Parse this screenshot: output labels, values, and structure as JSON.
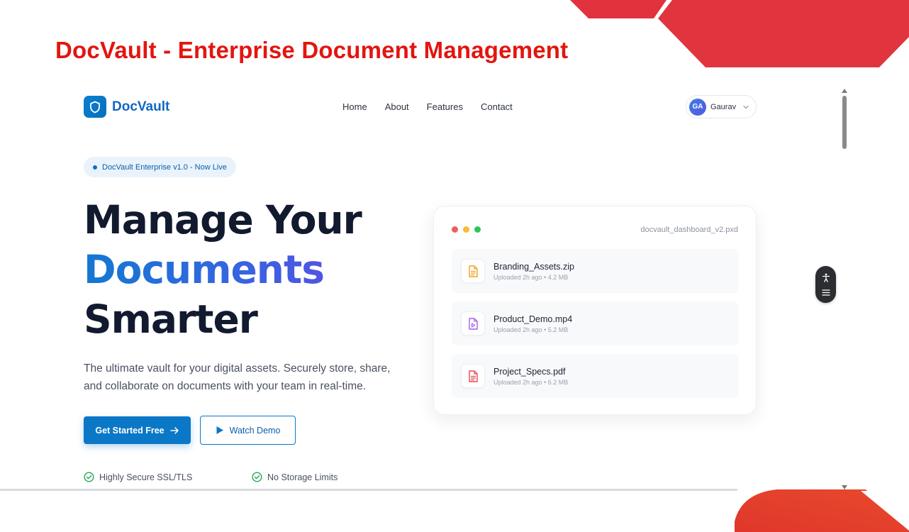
{
  "slide_title": "DocVault - Enterprise Document Management",
  "navbar": {
    "brand": "DocVault",
    "links": [
      "Home",
      "About",
      "Features",
      "Contact"
    ],
    "user": {
      "initials": "GA",
      "name": "Gaurav"
    }
  },
  "hero": {
    "badge": "DocVault Enterprise v1.0 - Now Live",
    "headline_line1": "Manage Your",
    "headline_line2": "Documents",
    "headline_line3": "Smarter",
    "subtext": "The ultimate vault for your digital assets. Securely store, share, and collaborate on documents with your team in real-time.",
    "primary_button": "Get Started Free",
    "secondary_button": "Watch Demo",
    "features": [
      "Highly Secure SSL/TLS",
      "No Storage Limits"
    ]
  },
  "dashboard_card": {
    "filename": "docvault_dashboard_v2.pxd",
    "files": [
      {
        "name": "Branding_Assets.zip",
        "meta": "Uploaded 2h ago • 4.2 MB",
        "icon": "document-icon",
        "color": "#f0a020"
      },
      {
        "name": "Product_Demo.mp4",
        "meta": "Uploaded 2h ago • 5.2 MB",
        "icon": "video-file-icon",
        "color": "#a55de8"
      },
      {
        "name": "Project_Specs.pdf",
        "meta": "Uploaded 2h ago • 6.2 MB",
        "icon": "pdf-file-icon",
        "color": "#e5484d"
      }
    ]
  },
  "colors": {
    "title_red": "#e3150f",
    "brand_blue": "#0b77c7",
    "check_green": "#22a55a",
    "window_dots": [
      "#ee5f5b",
      "#f5bd2f",
      "#2fc552"
    ]
  }
}
